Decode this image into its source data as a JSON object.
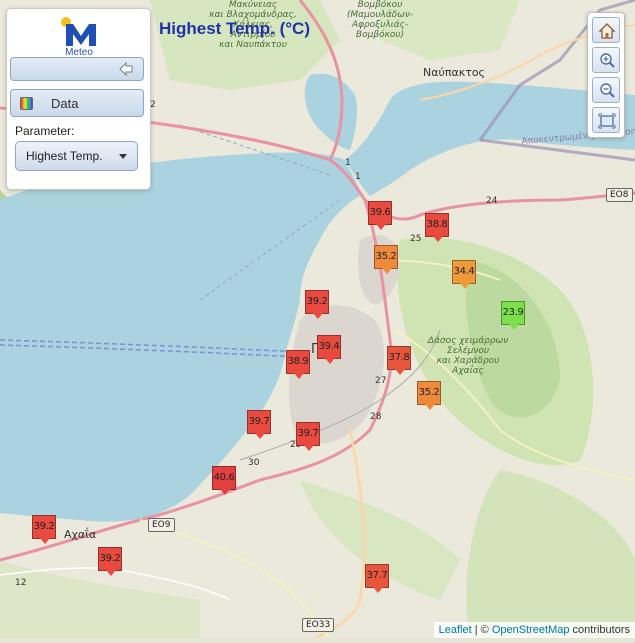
{
  "panel": {
    "logo_text": "Meteo",
    "data_label": "Data",
    "parameter_label": "Parameter:",
    "parameter_value": "Highest Temp."
  },
  "map": {
    "title": "Highest Temp. (°C)",
    "places": {
      "nafpaktos": "Ναύπακτος",
      "makyneias": "Μακύνειας\nκαι Βλαχομάνδρας,\nΧάλκιας,\nΑντιρρίου\nκαι Ναυπάκτου",
      "vomvokou": "Βομβόκου\n(Μαμουλάδων-\nΑφροξυλιάς-\nΒομβόκου)",
      "forest": "Δάσος χειμάρρων\nΣελέμνου\nκαι Χαράδρου\nΑχαΐας",
      "achaia": "Αχαΐα",
      "protected": "Αποκεντρωμένη Διοίκηση",
      "patra_partial": "Πά"
    },
    "roads": [
      "EO8",
      "EO9",
      "EO33"
    ],
    "road_numbers": [
      "1",
      "1",
      "2",
      "24",
      "25",
      "27",
      "28",
      "29",
      "30",
      "12"
    ]
  },
  "markers": [
    {
      "value": "39.6",
      "color": "#e84a3f"
    },
    {
      "value": "38.8",
      "color": "#e84a3f"
    },
    {
      "value": "35.2",
      "color": "#ee8a3a"
    },
    {
      "value": "34.4",
      "color": "#ef9a3a"
    },
    {
      "value": "39.2",
      "color": "#e84a3f"
    },
    {
      "value": "23.9",
      "color": "#7ce04a"
    },
    {
      "value": "39.4",
      "color": "#e84a3f"
    },
    {
      "value": "38.9",
      "color": "#e84a3f"
    },
    {
      "value": "37.8",
      "color": "#e7553d"
    },
    {
      "value": "35.2",
      "color": "#ee8a3a"
    },
    {
      "value": "39.7",
      "color": "#e84a3f"
    },
    {
      "value": "39.7",
      "color": "#e84a3f"
    },
    {
      "value": "40.6",
      "color": "#e4403f"
    },
    {
      "value": "39.2",
      "color": "#e84a3f"
    },
    {
      "value": "39.2",
      "color": "#e84a3f"
    },
    {
      "value": "37.7",
      "color": "#e7553d"
    }
  ],
  "attribution": {
    "leaflet": "Leaflet",
    "separator": " | © ",
    "osm": "OpenStreetMap",
    "suffix": " contributors"
  },
  "toolbar": {
    "home_icon": "home-icon",
    "zoom_in_icon": "zoom-in-icon",
    "zoom_out_icon": "zoom-out-icon",
    "extent_icon": "extent-icon"
  }
}
